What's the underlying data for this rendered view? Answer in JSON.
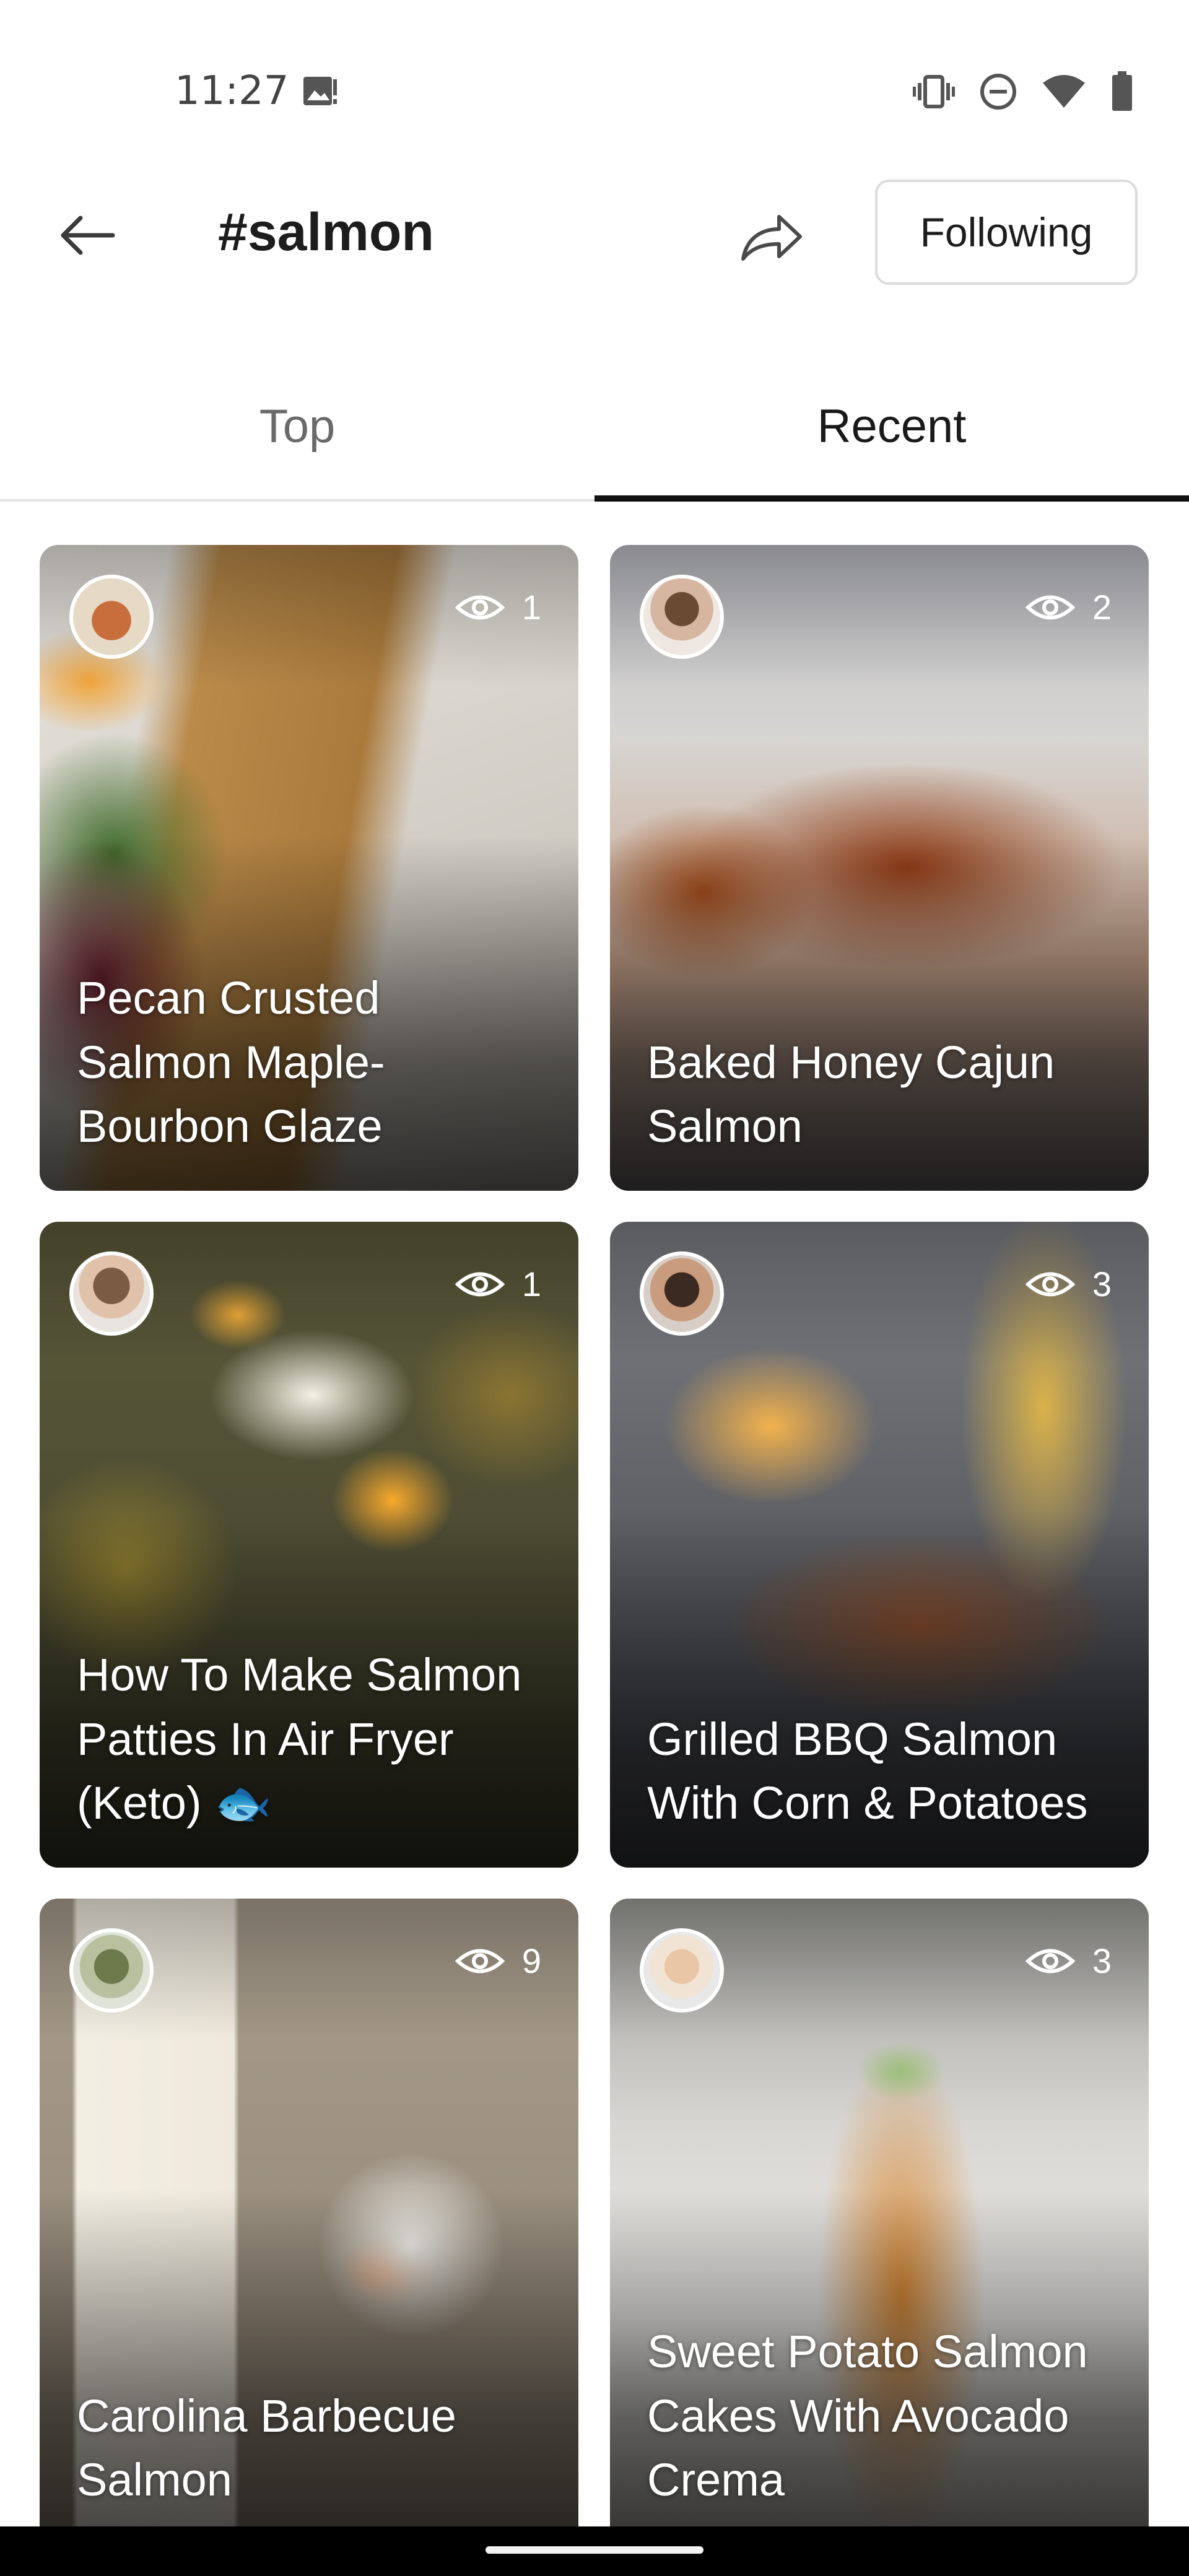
{
  "status_bar": {
    "time": "11:27",
    "icons": [
      "gallery-icon",
      "vibrate-icon",
      "do-not-disturb-icon",
      "wifi-icon",
      "battery-icon"
    ]
  },
  "header": {
    "title": "#salmon",
    "back_icon": "arrow-left-icon",
    "share_icon": "share-arrow-icon",
    "following_label": "Following"
  },
  "tabs": [
    {
      "label": "Top",
      "selected": false
    },
    {
      "label": "Recent",
      "selected": true
    }
  ],
  "cards": [
    {
      "title": "Pecan Crusted Salmon Maple-Bourbon Glaze",
      "views": "1"
    },
    {
      "title": "Baked Honey Cajun Salmon",
      "views": "2"
    },
    {
      "title": "How To Make Salmon Patties In Air Fryer (Keto) 🐟",
      "views": "1"
    },
    {
      "title": "Grilled BBQ Salmon With Corn & Potatoes",
      "views": "3"
    },
    {
      "title": "Carolina Barbecue Salmon",
      "views": "9"
    },
    {
      "title": "Sweet Potato Salmon Cakes With Avocado Crema",
      "views": "3"
    }
  ],
  "colors": {
    "accent": "#111111",
    "tab_inactive": "#6a6a6a",
    "nav_bar": "#000000"
  }
}
